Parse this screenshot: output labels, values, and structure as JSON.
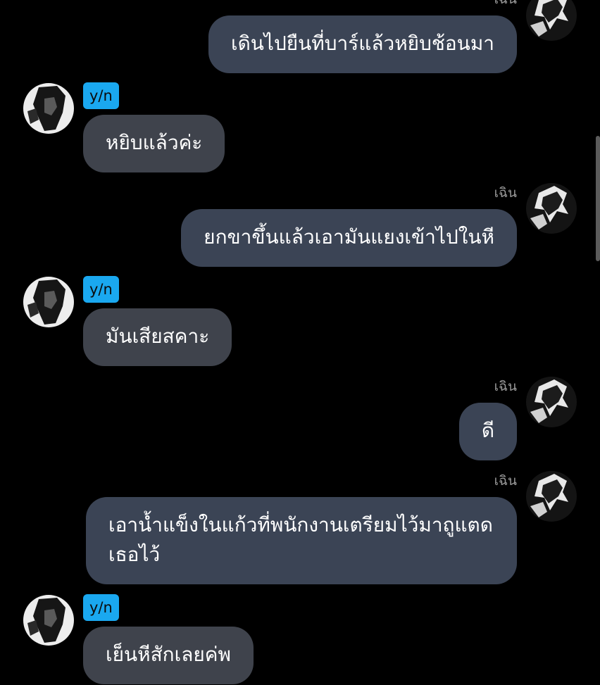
{
  "participants": {
    "other_name": "เฉิน",
    "me_name": "y/n"
  },
  "messages": [
    {
      "side": "right",
      "sender": "เฉิน",
      "text": "เดินไปยืนที่บาร์แล้วหยิบช้อนมา"
    },
    {
      "side": "left",
      "sender": "y/n",
      "text": "หยิบแล้วค่ะ"
    },
    {
      "side": "right",
      "sender": "เฉิน",
      "text": "ยกขาขึ้นแล้วเอามันแยงเข้าไปในหี"
    },
    {
      "side": "left",
      "sender": "y/n",
      "text": "มันเสียสคาะ"
    },
    {
      "side": "right",
      "sender": "เฉิน",
      "text": "ดี"
    },
    {
      "side": "right",
      "sender": "เฉิน",
      "text": "เอาน้ำแข็งในแก้วที่พนักงานเตรียมไว้มาถูแตดเธอไว้"
    },
    {
      "side": "left",
      "sender": "y/n",
      "text": "เย็นหีสักเลยค่พ"
    }
  ],
  "colors": {
    "background": "#000000",
    "bubble_right": "#3b4455",
    "bubble_left": "#3f434c",
    "name_tag": "#1aa8f0",
    "name_label": "#9a9a9a"
  },
  "icons": {
    "avatar_left": "portrait-avatar",
    "avatar_right": "portrait-avatar"
  }
}
